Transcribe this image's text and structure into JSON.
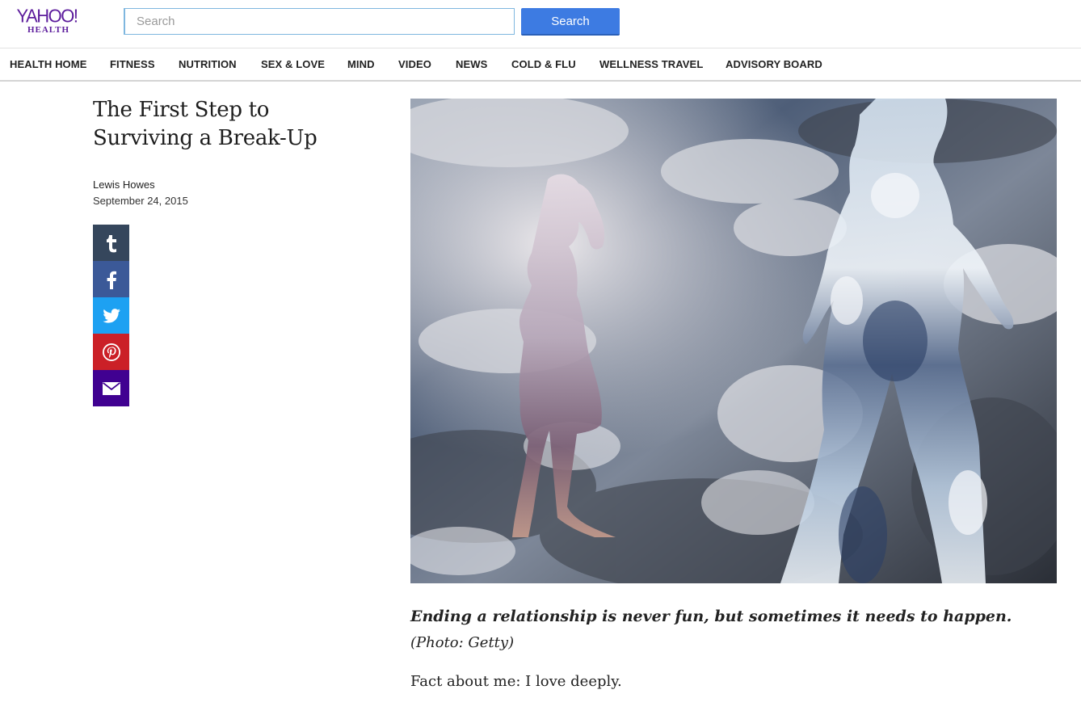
{
  "header": {
    "logo_text": "YAHOO!",
    "logo_sub": "HEALTH",
    "search_placeholder": "Search",
    "search_value": "",
    "search_button": "Search"
  },
  "nav": {
    "items": [
      {
        "label": "HEALTH HOME"
      },
      {
        "label": "FITNESS"
      },
      {
        "label": "NUTRITION"
      },
      {
        "label": "SEX & LOVE"
      },
      {
        "label": "MIND"
      },
      {
        "label": "VIDEO"
      },
      {
        "label": "NEWS"
      },
      {
        "label": "COLD & FLU"
      },
      {
        "label": "WELLNESS TRAVEL"
      },
      {
        "label": "ADVISORY BOARD"
      }
    ]
  },
  "article": {
    "title": "The First Step to Surviving a Break-Up",
    "author": "Lewis Howes",
    "date": "September 24, 2015",
    "caption": "Ending a relationship is never fun, but sometimes it needs to happen.",
    "photo_credit": "(Photo: Getty)",
    "first_paragraph": "Fact about me: I love deeply."
  },
  "share": [
    {
      "icon": "tumblr-icon",
      "color": "#35465c"
    },
    {
      "icon": "facebook-icon",
      "color": "#3b5998"
    },
    {
      "icon": "twitter-icon",
      "color": "#1da1f2"
    },
    {
      "icon": "pinterest-icon",
      "color": "#cb2027"
    },
    {
      "icon": "mail-icon",
      "color": "#400191"
    }
  ],
  "colors": {
    "brand": "#5c1c9c",
    "search_button": "#3d7be2",
    "search_border": "#7fb7df"
  }
}
